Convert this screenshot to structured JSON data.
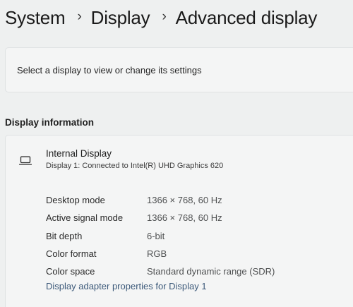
{
  "breadcrumb": {
    "items": [
      "System",
      "Display",
      "Advanced display"
    ],
    "separator": "›"
  },
  "select_display": {
    "text": "Select a display to view or change its settings"
  },
  "display_information": {
    "title": "Display information",
    "display": {
      "icon": "monitor-icon",
      "name": "Internal Display",
      "subtitle": "Display 1: Connected to Intel(R) UHD Graphics 620"
    },
    "rows": [
      {
        "label": "Desktop mode",
        "value": "1366 × 768, 60 Hz"
      },
      {
        "label": "Active signal mode",
        "value": "1366 × 768, 60 Hz"
      },
      {
        "label": "Bit depth",
        "value": "6-bit"
      },
      {
        "label": "Color format",
        "value": "RGB"
      },
      {
        "label": "Color space",
        "value": "Standard dynamic range (SDR)"
      }
    ],
    "adapter_link": "Display adapter properties for Display 1"
  },
  "colors": {
    "background": "#eef0f0",
    "card": "#f4f5f5",
    "link": "#3d5a7a"
  }
}
